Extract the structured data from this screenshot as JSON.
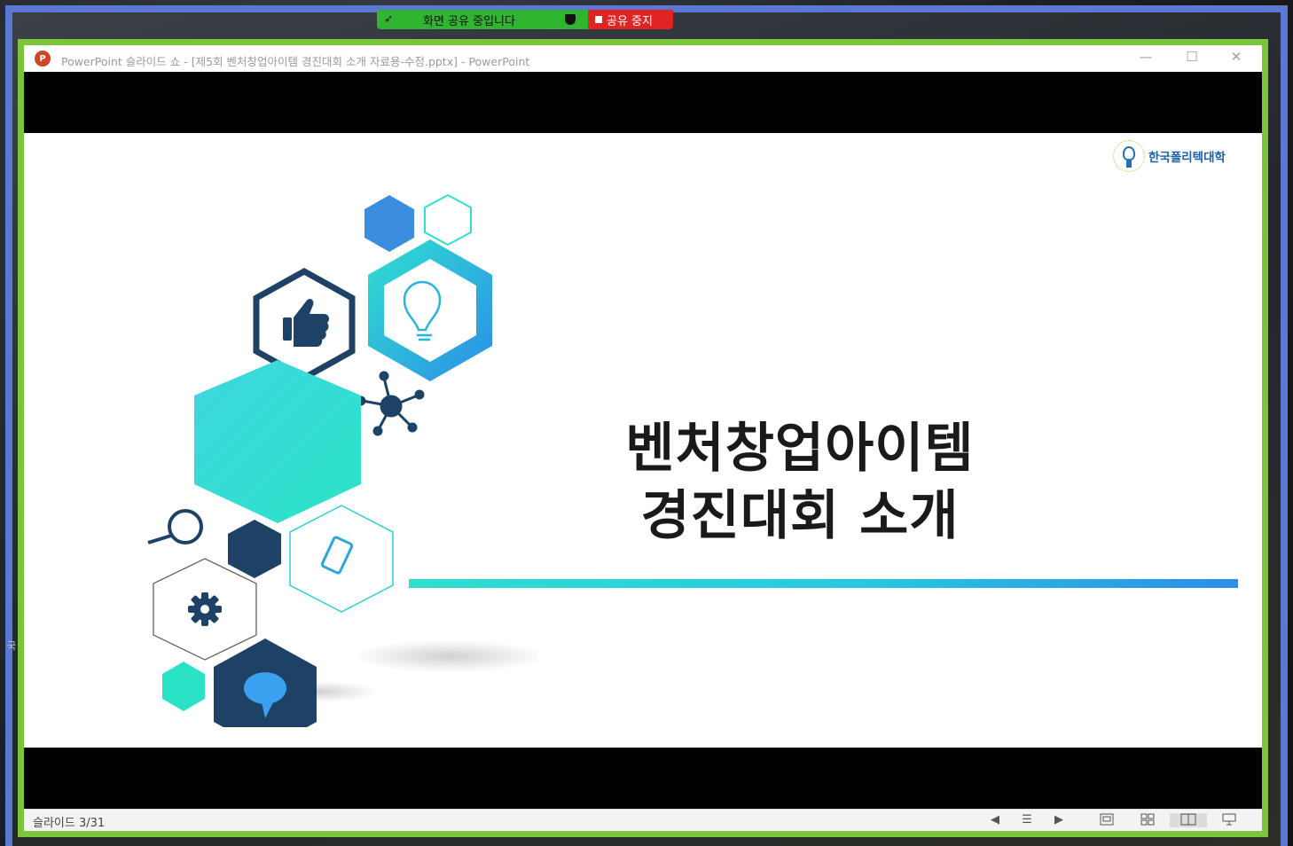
{
  "zoom": {
    "share_status": "화면 공유 중입니다",
    "stop_share_label": "공유 중지",
    "colors": {
      "share_bar": "#2fb52f",
      "stop": "#e02424",
      "window_border": "#7cc43a",
      "frame": "#5b79d2"
    }
  },
  "window": {
    "app_icon": "powerpoint-icon",
    "app_icon_text": "P",
    "title": "PowerPoint 슬라이드 쇼 - [제5회 벤처창업아이템 경진대회 소개 자료용-수정.pptx] - PowerPoint",
    "minimize_symbol": "—",
    "maximize_symbol": "☐",
    "close_symbol": "✕"
  },
  "slide": {
    "logo_text": "한국폴리텍대학",
    "title_line1": "벤처창업아이템",
    "title_line2": "경진대회 소개",
    "accent_gradient": [
      "#2de0cf",
      "#2c8ee8"
    ],
    "icons": [
      "thumbs-up-icon",
      "lightbulb-icon",
      "network-icon",
      "magnifier-icon",
      "phone-icon",
      "gear-icon",
      "speech-bubble-icon"
    ]
  },
  "statusbar": {
    "slide_counter": "슬라이드 3/31",
    "prev_symbol": "◀",
    "menu_symbol": "☰",
    "next_symbol": "▶"
  },
  "edge_char": "국"
}
